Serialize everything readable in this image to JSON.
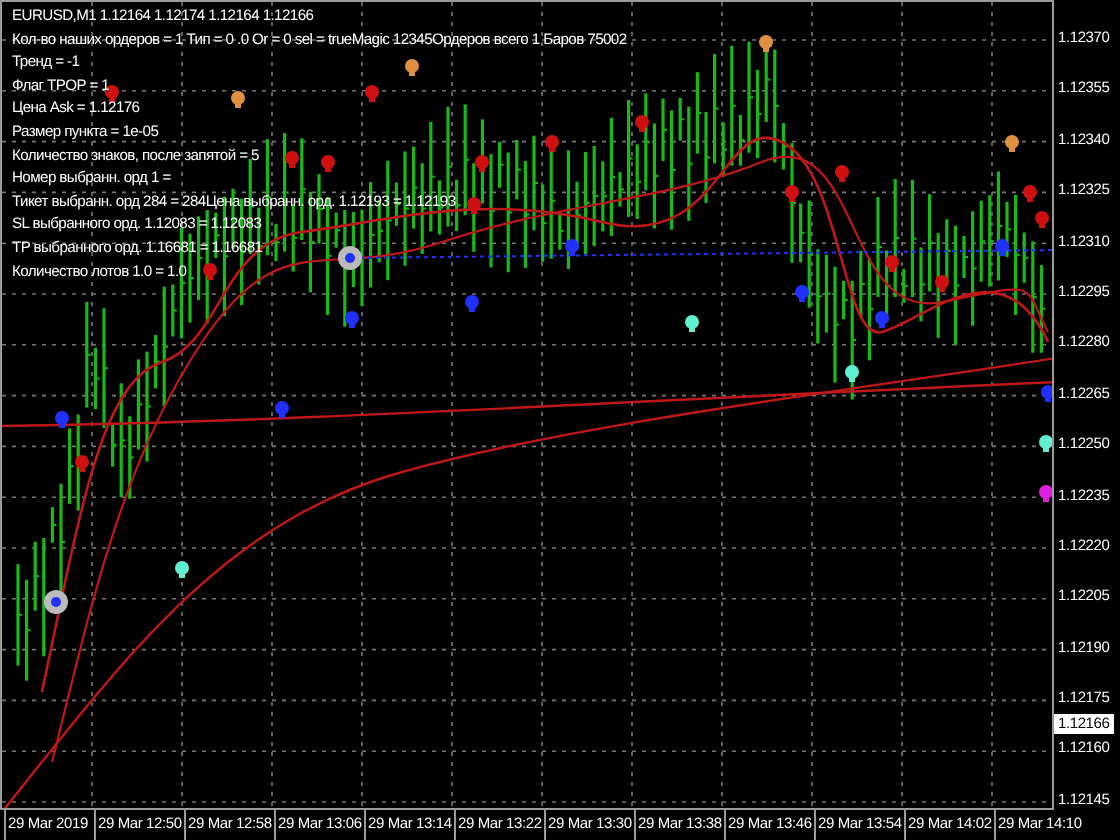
{
  "chart_header": "EURUSD,M1  1.12164 1.12174 1.12164 1.12166",
  "info_lines": [
    "Кол-во наших ордеров = 1 Тип = 0 .0 Or = 0 sel = trueMagic 12345Ордеров всего 1 Баров 75002",
    "Тренд = -1",
    "Флаг TPOP = 1",
    "Цена Ask = 1.12176",
    "Размер пункта = 1e-05",
    "Количество знаков, после запятой = 5",
    "Номер выбранн. орд 1 =",
    "Тикет выбранн. орд 284 = 284Цена выбранн. орд. 1.12193 = 1.12193",
    "SL выбранного орд.  1.12083 = 1.12083",
    "TP выбранного орд.  1.16681 = 1.16681",
    "Количество лотов  1.0 = 1.0"
  ],
  "price_axis": [
    "1.12370",
    "1.12355",
    "1.12340",
    "1.12325",
    "1.12310",
    "1.12295",
    "1.12280",
    "1.12265",
    "1.12250",
    "1.12235",
    "1.12220",
    "1.12205",
    "1.12190",
    "1.12175",
    "1.12160",
    "1.12145"
  ],
  "current_price": "1.12166",
  "time_axis": [
    "29 Mar 2019",
    "29 Mar 12:50",
    "29 Mar 12:58",
    "29 Mar 13:06",
    "29 Mar 13:14",
    "29 Mar 13:22",
    "29 Mar 13:30",
    "29 Mar 13:38",
    "29 Mar 13:46",
    "29 Mar 13:54",
    "29 Mar 14:02",
    "29 Mar 14:10"
  ]
}
